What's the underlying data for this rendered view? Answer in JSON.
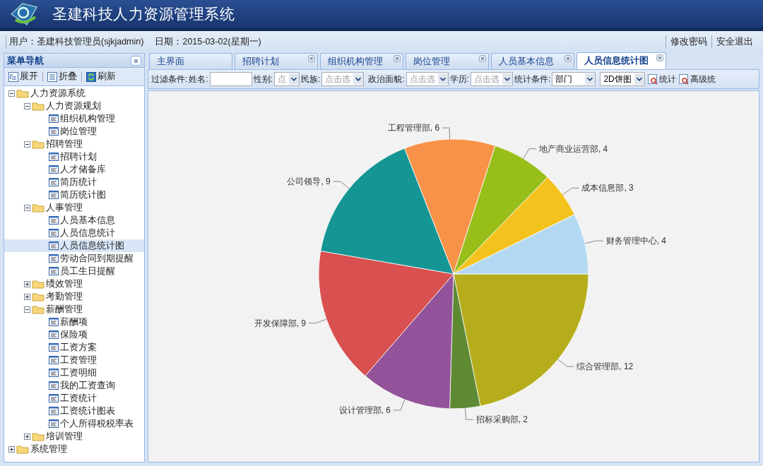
{
  "app_title": "圣建科技人力资源管理系统",
  "info_bar": {
    "user": "用户：圣建科技管理员(sjkjadmin)",
    "date": "日期：2015-03-02(星期一)",
    "links": [
      "修改密码",
      "安全退出"
    ]
  },
  "sidebar": {
    "title": "菜单导航",
    "collapse": "«",
    "toolbar": [
      "展开",
      "折叠",
      "刷新"
    ],
    "tree": [
      {
        "label": "人力资源系统",
        "expanded": true,
        "children": [
          {
            "label": "人力资源规划",
            "expanded": true,
            "children": [
              {
                "label": "组织机构管理",
                "selected": false
              },
              {
                "label": "岗位管理",
                "selected": false
              }
            ]
          },
          {
            "label": "招聘管理",
            "expanded": true,
            "children": [
              {
                "label": "招聘计划",
                "selected": false
              },
              {
                "label": "人才储备库",
                "selected": false
              },
              {
                "label": "简历统计",
                "selected": false
              },
              {
                "label": "简历统计图",
                "selected": false
              }
            ]
          },
          {
            "label": "人事管理",
            "expanded": true,
            "children": [
              {
                "label": "人员基本信息",
                "selected": false
              },
              {
                "label": "人员信息统计",
                "selected": false
              },
              {
                "label": "人员信息统计图",
                "selected": true
              },
              {
                "label": "劳动合同到期提醒",
                "selected": false
              },
              {
                "label": "员工生日提醒",
                "selected": false
              }
            ]
          },
          {
            "label": "绩效管理",
            "expanded": false
          },
          {
            "label": "考勤管理",
            "expanded": false
          },
          {
            "label": "薪酬管理",
            "expanded": true,
            "children": [
              {
                "label": "薪酬项",
                "selected": false
              },
              {
                "label": "保险项",
                "selected": false
              },
              {
                "label": "工资方案",
                "selected": false
              },
              {
                "label": "工资管理",
                "selected": false
              },
              {
                "label": "工资明细",
                "selected": false
              },
              {
                "label": "我的工资查询",
                "selected": false
              },
              {
                "label": "工资统计",
                "selected": false
              },
              {
                "label": "工资统计图表",
                "selected": false
              },
              {
                "label": "个人所得税税率表",
                "selected": false
              }
            ]
          },
          {
            "label": "培训管理",
            "expanded": false
          }
        ]
      },
      {
        "label": "系统管理",
        "expanded": false
      }
    ]
  },
  "tabs": [
    {
      "label": "主界面",
      "selected": false,
      "closable": false
    },
    {
      "label": "招聘计划",
      "selected": false,
      "closable": true
    },
    {
      "label": "组织机构管理",
      "selected": false,
      "closable": true
    },
    {
      "label": "岗位管理",
      "selected": false,
      "closable": true
    },
    {
      "label": "人员基本信息",
      "selected": false,
      "closable": true
    },
    {
      "label": "人员信息统计图",
      "selected": true,
      "closable": true
    }
  ],
  "filter": {
    "title": "过滤条件:",
    "fields": [
      {
        "kind": "text",
        "label": "姓名:"
      },
      {
        "kind": "select",
        "label": "性别:",
        "placeholder": "点"
      },
      {
        "kind": "select",
        "label": "民族:",
        "placeholder": "点击选"
      },
      {
        "kind": "select",
        "label": "政治面貌:",
        "placeholder": "点击选"
      },
      {
        "kind": "select",
        "label": "学历:",
        "placeholder": "点击选"
      },
      {
        "kind": "select",
        "label": "统计条件:",
        "value": "部门"
      },
      {
        "kind": "select",
        "value": "2D饼图"
      }
    ],
    "buttons": [
      "统计",
      "高级统"
    ]
  },
  "chart_data": {
    "type": "pie",
    "categories": [
      "综合管理部, 12",
      "招标采购部, 2",
      "设计管理部, 6",
      "开发保障部, 9",
      "公司领导, 9",
      "工程管理部, 6",
      "地产商业运营部, 4",
      "成本信息部, 3",
      "财务管理中心, 4"
    ],
    "values": [
      12,
      2,
      6,
      9,
      9,
      6,
      4,
      3,
      4
    ],
    "colors": [
      "#b5ad1b",
      "#5f8a34",
      "#92539a",
      "#d85050",
      "#169595",
      "#f89248",
      "#98be1a",
      "#f4c21c",
      "#b3d9f2"
    ]
  }
}
